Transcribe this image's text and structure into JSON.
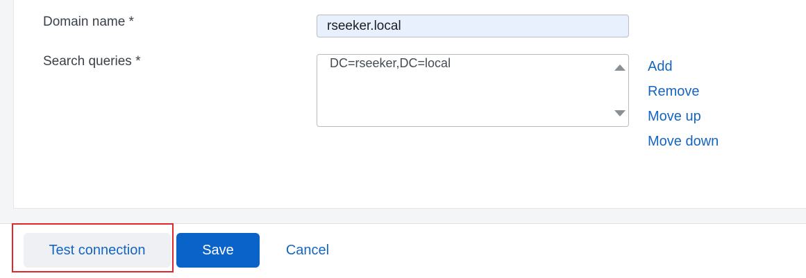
{
  "form": {
    "domain_name_label": "Domain name *",
    "domain_name_value": "rseeker.local",
    "search_queries_label": "Search queries *",
    "search_queries": [
      "DC=rseeker,DC=local"
    ]
  },
  "query_actions": {
    "add": "Add",
    "remove": "Remove",
    "move_up": "Move up",
    "move_down": "Move down"
  },
  "footer": {
    "test_connection": "Test connection",
    "save": "Save",
    "cancel": "Cancel"
  },
  "colors": {
    "link": "#1565c0",
    "primary_button": "#0a63c9",
    "highlight": "#e0262b",
    "autofill_bg": "#e8f0fe"
  }
}
